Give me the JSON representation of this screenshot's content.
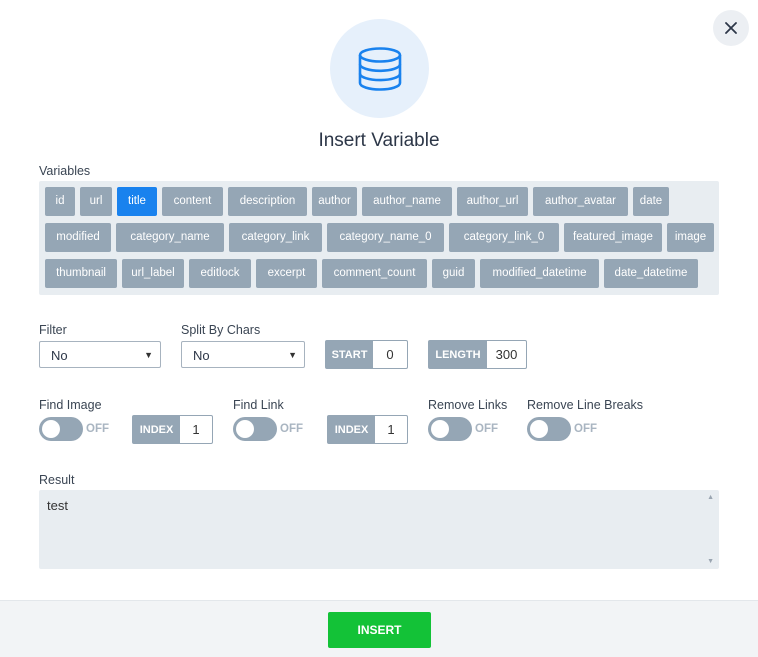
{
  "dialog": {
    "title": "Insert Variable",
    "icon": "database-icon",
    "accent_color": "#1982ee"
  },
  "variables": {
    "label": "Variables",
    "selected": "title",
    "rows": [
      [
        "id",
        "url",
        "title",
        "content",
        "description",
        "author",
        "author_name",
        "author_url",
        "author_avatar",
        "date"
      ],
      [
        "modified",
        "category_name",
        "category_link",
        "category_name_0",
        "category_link_0",
        "featured_image",
        "image"
      ],
      [
        "thumbnail",
        "url_label",
        "editlock",
        "excerpt",
        "comment_count",
        "guid",
        "modified_datetime",
        "date_datetime"
      ]
    ]
  },
  "filter": {
    "label": "Filter",
    "value": "No"
  },
  "split": {
    "label": "Split By Chars",
    "value": "No"
  },
  "start": {
    "tag": "START",
    "value": "0"
  },
  "length": {
    "tag": "LENGTH",
    "value": "300"
  },
  "find_image": {
    "label": "Find Image",
    "state": "OFF",
    "index_tag": "INDEX",
    "index_value": "1"
  },
  "find_link": {
    "label": "Find Link",
    "state": "OFF",
    "index_tag": "INDEX",
    "index_value": "1"
  },
  "remove_links": {
    "label": "Remove Links",
    "state": "OFF"
  },
  "remove_line_breaks": {
    "label": "Remove Line Breaks",
    "state": "OFF"
  },
  "result": {
    "label": "Result",
    "value": "test"
  },
  "footer": {
    "insert_label": "INSERT",
    "insert_color": "#13c237"
  }
}
